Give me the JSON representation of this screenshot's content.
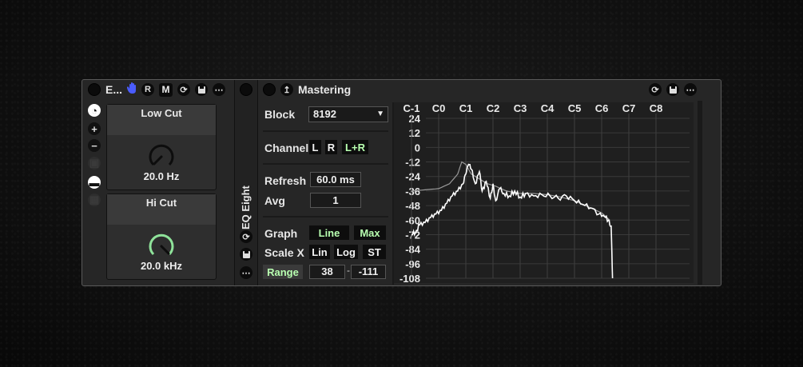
{
  "eq_panel": {
    "title": "E...",
    "buttons": {
      "hand": "hand-icon",
      "r": "R",
      "m": "M"
    },
    "knobs": [
      {
        "title": "Low Cut",
        "value": "20.0 Hz",
        "level": 0.0
      },
      {
        "title": "Hi Cut",
        "value": "20.0 kHz",
        "level": 1.0
      }
    ],
    "side_buttons": [
      "+",
      "−"
    ]
  },
  "divider": {
    "label": "EQ Eight"
  },
  "analyzer": {
    "title": "Mastering",
    "block": {
      "label": "Block",
      "value": "8192"
    },
    "channel": {
      "label": "Channel",
      "options": [
        "L",
        "R",
        "L+R"
      ],
      "selected": "L+R"
    },
    "refresh": {
      "label": "Refresh",
      "value": "60.0 ms"
    },
    "avg": {
      "label": "Avg",
      "value": "1"
    },
    "graph_mode": {
      "label": "Graph",
      "options": [
        "Line",
        "Max"
      ]
    },
    "scale_x": {
      "label": "Scale X",
      "options": [
        "Lin",
        "Log",
        "ST"
      ]
    },
    "range": {
      "label": "Range",
      "min": "38",
      "dash": "-",
      "max": "-111"
    }
  },
  "chart_data": {
    "type": "line",
    "x_tick_labels": [
      "C-1",
      "C0",
      "C1",
      "C2",
      "C3",
      "C4",
      "C5",
      "C6",
      "C7",
      "C8"
    ],
    "y_tick_labels": [
      "24",
      "12",
      "0",
      "-12",
      "-24",
      "-36",
      "-48",
      "-60",
      "-72",
      "-84",
      "-96",
      "-108"
    ],
    "ylim": [
      -108,
      24
    ],
    "series": [
      {
        "color": "#ffffff",
        "points": [
          [
            0,
            -72
          ],
          [
            0.15,
            -70
          ],
          [
            0.3,
            -64
          ],
          [
            0.5,
            -62
          ],
          [
            0.7,
            -58
          ],
          [
            0.9,
            -55
          ],
          [
            1.1,
            -52
          ],
          [
            1.3,
            -46
          ],
          [
            1.5,
            -40
          ],
          [
            1.7,
            -36
          ],
          [
            1.9,
            -30
          ],
          [
            2.0,
            -22
          ],
          [
            2.1,
            -14
          ],
          [
            2.2,
            -18
          ],
          [
            2.35,
            -30
          ],
          [
            2.5,
            -20
          ],
          [
            2.6,
            -36
          ],
          [
            2.75,
            -28
          ],
          [
            2.9,
            -42
          ],
          [
            3.0,
            -30
          ],
          [
            3.1,
            -44
          ],
          [
            3.25,
            -34
          ],
          [
            3.4,
            -38
          ],
          [
            3.6,
            -40
          ],
          [
            3.8,
            -36
          ],
          [
            4.0,
            -41
          ],
          [
            4.2,
            -38
          ],
          [
            4.5,
            -40
          ],
          [
            4.8,
            -39
          ],
          [
            5.1,
            -40
          ],
          [
            5.4,
            -42
          ],
          [
            5.7,
            -40
          ],
          [
            6.0,
            -44
          ],
          [
            6.3,
            -47
          ],
          [
            6.6,
            -50
          ],
          [
            6.9,
            -55
          ],
          [
            7.1,
            -57
          ],
          [
            7.25,
            -60
          ],
          [
            7.35,
            -65
          ],
          [
            7.4,
            -108
          ]
        ]
      },
      {
        "color": "#9a9a9a",
        "points": [
          [
            0,
            -36
          ],
          [
            0.5,
            -35
          ],
          [
            1.0,
            -34
          ],
          [
            1.4,
            -30
          ],
          [
            1.7,
            -22
          ],
          [
            1.85,
            -12
          ],
          [
            2.0,
            -14
          ],
          [
            2.2,
            -22
          ],
          [
            2.5,
            -26
          ],
          [
            2.8,
            -30
          ],
          [
            3.1,
            -32
          ],
          [
            3.5,
            -36
          ],
          [
            4.0,
            -38
          ],
          [
            4.5,
            -38
          ],
          [
            5.0,
            -39
          ],
          [
            5.5,
            -41
          ],
          [
            6.0,
            -44
          ],
          [
            6.5,
            -49
          ],
          [
            7.0,
            -54
          ],
          [
            7.3,
            -60
          ]
        ]
      }
    ]
  }
}
